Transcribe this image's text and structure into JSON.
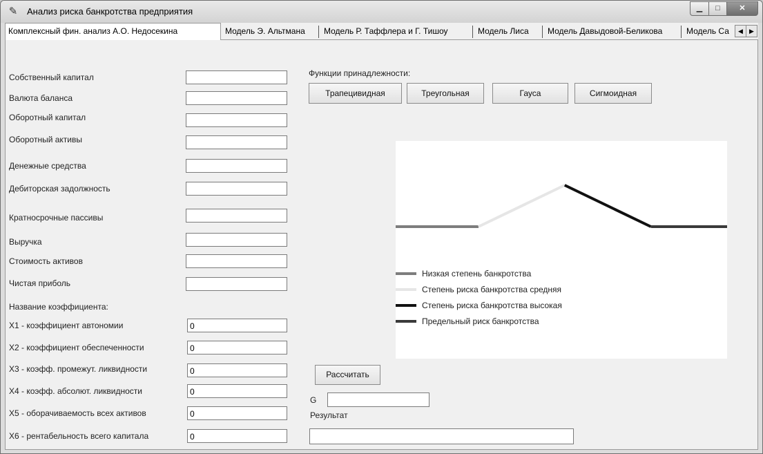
{
  "window": {
    "title": "Анализ риска банкротства предприятия"
  },
  "tabs": [
    {
      "label": "Комплексный фин. анализ А.О. Недосекина"
    },
    {
      "label": "Модель Э. Альтмана"
    },
    {
      "label": "Модель Р. Таффлера и Г. Тишоу"
    },
    {
      "label": "Модель Лиса"
    },
    {
      "label": "Модель Давыдовой-Беликова"
    },
    {
      "label": "Модель Са"
    }
  ],
  "inputs": [
    {
      "label": "Собственный капитал",
      "value": ""
    },
    {
      "label": "Валюта баланса",
      "value": ""
    },
    {
      "label": "Оборотный капитал",
      "value": ""
    },
    {
      "label": "Оборотный активы",
      "value": ""
    },
    {
      "label": "Денежные средства",
      "value": ""
    },
    {
      "label": "Дебиторская задолжность",
      "value": ""
    },
    {
      "label": "Кратносрочные пассивы",
      "value": ""
    },
    {
      "label": "Выручка",
      "value": ""
    },
    {
      "label": "Стоимость активов",
      "value": ""
    },
    {
      "label": "Чистая приболь",
      "value": ""
    }
  ],
  "coef_header": "Название коэффициента:",
  "coefficients": [
    {
      "label": "X1 - коэффициент автономии",
      "value": "0"
    },
    {
      "label": "X2 - коэффициент обеспеченности",
      "value": "0"
    },
    {
      "label": "X3 - коэфф. промежут. ликвидности",
      "value": "0"
    },
    {
      "label": "X4 - коэфф. абсолют. ликвидности",
      "value": "0"
    },
    {
      "label": "X5 -  оборачиваемость всех активов",
      "value": "0"
    },
    {
      "label": "X6 - рентабельность всего капитала",
      "value": "0"
    }
  ],
  "membership": {
    "header": "Функции принадлежности:",
    "buttons": [
      {
        "label": "Трапецивидная"
      },
      {
        "label": "Треугольная"
      },
      {
        "label": "Гауса"
      },
      {
        "label": "Сигмоидная"
      }
    ]
  },
  "chart_data": {
    "type": "line",
    "xlim": [
      0,
      100
    ],
    "ylim": [
      0,
      1
    ],
    "grid": false,
    "legend_placement": "bottom-left",
    "series": [
      {
        "name": "Низкая степень банкротства",
        "color": "#7d7d7d",
        "points": [
          [
            0,
            0
          ],
          [
            25,
            0
          ]
        ]
      },
      {
        "name": "Степень риска банкротства средняя",
        "color": "#e6e6e6",
        "points": [
          [
            25,
            0
          ],
          [
            51,
            1
          ]
        ]
      },
      {
        "name": "Степень риска банкротства высокая",
        "color": "#111111",
        "points": [
          [
            51,
            1
          ],
          [
            77,
            0
          ]
        ]
      },
      {
        "name": "Предельный риск банкротства",
        "color": "#3a3a3a",
        "points": [
          [
            77,
            0
          ],
          [
            100,
            0
          ]
        ]
      }
    ]
  },
  "calc_label": "Рассчитать",
  "g": {
    "label": "G",
    "value": ""
  },
  "result": {
    "label": "Результат",
    "value": ""
  },
  "icons": {
    "app": "chart-icon",
    "tab_left": "arrow-left-icon",
    "tab_right": "arrow-right-icon"
  }
}
